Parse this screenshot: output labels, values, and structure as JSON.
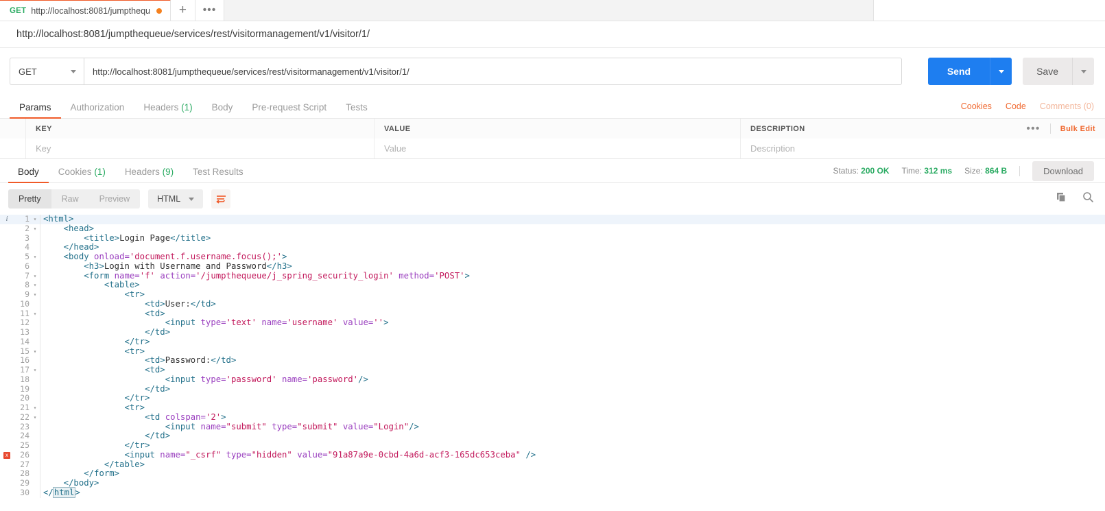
{
  "tab": {
    "method": "GET",
    "title": "http://localhost:8081/jumpthequ",
    "add_label": "+",
    "more_label": "•••"
  },
  "url_title": "http://localhost:8081/jumpthequeue/services/rest/visitormanagement/v1/visitor/1/",
  "request": {
    "method": "GET",
    "url": "http://localhost:8081/jumpthequeue/services/rest/visitormanagement/v1/visitor/1/",
    "send_label": "Send",
    "save_label": "Save"
  },
  "request_tabs": [
    {
      "label": "Params",
      "count": "",
      "active": true
    },
    {
      "label": "Authorization",
      "count": "",
      "active": false
    },
    {
      "label": "Headers",
      "count": "(1)",
      "active": false
    },
    {
      "label": "Body",
      "count": "",
      "active": false
    },
    {
      "label": "Pre-request Script",
      "count": "",
      "active": false
    },
    {
      "label": "Tests",
      "count": "",
      "active": false
    }
  ],
  "request_tabs_right": {
    "cookies": "Cookies",
    "code": "Code",
    "comments": "Comments (0)"
  },
  "params_table": {
    "headers": {
      "key": "KEY",
      "value": "VALUE",
      "description": "DESCRIPTION"
    },
    "placeholder_row": {
      "key": "Key",
      "value": "Value",
      "description": "Description"
    },
    "dots": "•••",
    "bulk_edit": "Bulk Edit"
  },
  "response_tabs": [
    {
      "label": "Body",
      "count": "",
      "active": true
    },
    {
      "label": "Cookies",
      "count": "(1)",
      "active": false
    },
    {
      "label": "Headers",
      "count": "(9)",
      "active": false
    },
    {
      "label": "Test Results",
      "count": "",
      "active": false
    }
  ],
  "response_meta": {
    "status_label": "Status:",
    "status_value": "200 OK",
    "time_label": "Time:",
    "time_value": "312 ms",
    "size_label": "Size:",
    "size_value": "864 B",
    "download": "Download"
  },
  "body_toolbar": {
    "views": [
      {
        "label": "Pretty",
        "active": true
      },
      {
        "label": "Raw",
        "active": false
      },
      {
        "label": "Preview",
        "active": false
      }
    ],
    "format": "HTML",
    "wrap_icon": "word-wrap-icon",
    "copy_icon": "copy-icon",
    "search_icon": "search-icon"
  },
  "colors": {
    "accent_orange": "#f05a28",
    "send_blue": "#1e7ef0",
    "status_green": "#2bab63",
    "error_red": "#e8492f"
  },
  "code": {
    "info_glyph": "i",
    "error_glyph": "x",
    "fold_glyph": "▾",
    "lines": [
      {
        "n": 1,
        "fold": true,
        "info": true,
        "error": false,
        "highlight": true,
        "indent": 0,
        "tokens": [
          {
            "t": "tag",
            "v": "<html>"
          }
        ]
      },
      {
        "n": 2,
        "fold": true,
        "info": false,
        "error": false,
        "highlight": false,
        "indent": 1,
        "tokens": [
          {
            "t": "tag",
            "v": "<head>"
          }
        ]
      },
      {
        "n": 3,
        "fold": false,
        "info": false,
        "error": false,
        "highlight": false,
        "indent": 2,
        "tokens": [
          {
            "t": "tag",
            "v": "<title>"
          },
          {
            "t": "txt",
            "v": "Login Page"
          },
          {
            "t": "tag",
            "v": "</title>"
          }
        ]
      },
      {
        "n": 4,
        "fold": false,
        "info": false,
        "error": false,
        "highlight": false,
        "indent": 1,
        "tokens": [
          {
            "t": "tag",
            "v": "</head>"
          }
        ]
      },
      {
        "n": 5,
        "fold": true,
        "info": false,
        "error": false,
        "highlight": false,
        "indent": 1,
        "tokens": [
          {
            "t": "tag",
            "v": "<body "
          },
          {
            "t": "attr",
            "v": "onload="
          },
          {
            "t": "str",
            "v": "'document.f.username.focus();'"
          },
          {
            "t": "tag",
            "v": ">"
          }
        ]
      },
      {
        "n": 6,
        "fold": false,
        "info": false,
        "error": false,
        "highlight": false,
        "indent": 2,
        "tokens": [
          {
            "t": "tag",
            "v": "<h3>"
          },
          {
            "t": "txt",
            "v": "Login with Username and Password"
          },
          {
            "t": "tag",
            "v": "</h3>"
          }
        ]
      },
      {
        "n": 7,
        "fold": true,
        "info": false,
        "error": false,
        "highlight": false,
        "indent": 2,
        "tokens": [
          {
            "t": "tag",
            "v": "<form "
          },
          {
            "t": "attr",
            "v": "name="
          },
          {
            "t": "str",
            "v": "'f'"
          },
          {
            "t": "txt",
            "v": " "
          },
          {
            "t": "attr",
            "v": "action="
          },
          {
            "t": "str",
            "v": "'/jumpthequeue/j_spring_security_login'"
          },
          {
            "t": "txt",
            "v": " "
          },
          {
            "t": "attr",
            "v": "method="
          },
          {
            "t": "str",
            "v": "'POST'"
          },
          {
            "t": "tag",
            "v": ">"
          }
        ]
      },
      {
        "n": 8,
        "fold": true,
        "info": false,
        "error": false,
        "highlight": false,
        "indent": 3,
        "tokens": [
          {
            "t": "tag",
            "v": "<table>"
          }
        ]
      },
      {
        "n": 9,
        "fold": true,
        "info": false,
        "error": false,
        "highlight": false,
        "indent": 4,
        "tokens": [
          {
            "t": "tag",
            "v": "<tr>"
          }
        ]
      },
      {
        "n": 10,
        "fold": false,
        "info": false,
        "error": false,
        "highlight": false,
        "indent": 5,
        "tokens": [
          {
            "t": "tag",
            "v": "<td>"
          },
          {
            "t": "txt",
            "v": "User:"
          },
          {
            "t": "tag",
            "v": "</td>"
          }
        ]
      },
      {
        "n": 11,
        "fold": true,
        "info": false,
        "error": false,
        "highlight": false,
        "indent": 5,
        "tokens": [
          {
            "t": "tag",
            "v": "<td>"
          }
        ]
      },
      {
        "n": 12,
        "fold": false,
        "info": false,
        "error": false,
        "highlight": false,
        "indent": 6,
        "tokens": [
          {
            "t": "tag",
            "v": "<input "
          },
          {
            "t": "attr",
            "v": "type="
          },
          {
            "t": "str",
            "v": "'text'"
          },
          {
            "t": "txt",
            "v": " "
          },
          {
            "t": "attr",
            "v": "name="
          },
          {
            "t": "str",
            "v": "'username'"
          },
          {
            "t": "txt",
            "v": " "
          },
          {
            "t": "attr",
            "v": "value="
          },
          {
            "t": "str",
            "v": "''"
          },
          {
            "t": "tag",
            "v": ">"
          }
        ]
      },
      {
        "n": 13,
        "fold": false,
        "info": false,
        "error": false,
        "highlight": false,
        "indent": 5,
        "tokens": [
          {
            "t": "tag",
            "v": "</td>"
          }
        ]
      },
      {
        "n": 14,
        "fold": false,
        "info": false,
        "error": false,
        "highlight": false,
        "indent": 4,
        "tokens": [
          {
            "t": "tag",
            "v": "</tr>"
          }
        ]
      },
      {
        "n": 15,
        "fold": true,
        "info": false,
        "error": false,
        "highlight": false,
        "indent": 4,
        "tokens": [
          {
            "t": "tag",
            "v": "<tr>"
          }
        ]
      },
      {
        "n": 16,
        "fold": false,
        "info": false,
        "error": false,
        "highlight": false,
        "indent": 5,
        "tokens": [
          {
            "t": "tag",
            "v": "<td>"
          },
          {
            "t": "txt",
            "v": "Password:"
          },
          {
            "t": "tag",
            "v": "</td>"
          }
        ]
      },
      {
        "n": 17,
        "fold": true,
        "info": false,
        "error": false,
        "highlight": false,
        "indent": 5,
        "tokens": [
          {
            "t": "tag",
            "v": "<td>"
          }
        ]
      },
      {
        "n": 18,
        "fold": false,
        "info": false,
        "error": false,
        "highlight": false,
        "indent": 6,
        "tokens": [
          {
            "t": "tag",
            "v": "<input "
          },
          {
            "t": "attr",
            "v": "type="
          },
          {
            "t": "str",
            "v": "'password'"
          },
          {
            "t": "txt",
            "v": " "
          },
          {
            "t": "attr",
            "v": "name="
          },
          {
            "t": "str",
            "v": "'password'"
          },
          {
            "t": "tag",
            "v": "/>"
          }
        ]
      },
      {
        "n": 19,
        "fold": false,
        "info": false,
        "error": false,
        "highlight": false,
        "indent": 5,
        "tokens": [
          {
            "t": "tag",
            "v": "</td>"
          }
        ]
      },
      {
        "n": 20,
        "fold": false,
        "info": false,
        "error": false,
        "highlight": false,
        "indent": 4,
        "tokens": [
          {
            "t": "tag",
            "v": "</tr>"
          }
        ]
      },
      {
        "n": 21,
        "fold": true,
        "info": false,
        "error": false,
        "highlight": false,
        "indent": 4,
        "tokens": [
          {
            "t": "tag",
            "v": "<tr>"
          }
        ]
      },
      {
        "n": 22,
        "fold": true,
        "info": false,
        "error": false,
        "highlight": false,
        "indent": 5,
        "tokens": [
          {
            "t": "tag",
            "v": "<td "
          },
          {
            "t": "attr",
            "v": "colspan="
          },
          {
            "t": "str",
            "v": "'2'"
          },
          {
            "t": "tag",
            "v": ">"
          }
        ]
      },
      {
        "n": 23,
        "fold": false,
        "info": false,
        "error": false,
        "highlight": false,
        "indent": 6,
        "tokens": [
          {
            "t": "tag",
            "v": "<input "
          },
          {
            "t": "attr",
            "v": "name="
          },
          {
            "t": "str",
            "v": "\"submit\""
          },
          {
            "t": "txt",
            "v": " "
          },
          {
            "t": "attr",
            "v": "type="
          },
          {
            "t": "str",
            "v": "\"submit\""
          },
          {
            "t": "txt",
            "v": " "
          },
          {
            "t": "attr",
            "v": "value="
          },
          {
            "t": "str",
            "v": "\"Login\""
          },
          {
            "t": "tag",
            "v": "/>"
          }
        ]
      },
      {
        "n": 24,
        "fold": false,
        "info": false,
        "error": false,
        "highlight": false,
        "indent": 5,
        "tokens": [
          {
            "t": "tag",
            "v": "</td>"
          }
        ]
      },
      {
        "n": 25,
        "fold": false,
        "info": false,
        "error": false,
        "highlight": false,
        "indent": 4,
        "tokens": [
          {
            "t": "tag",
            "v": "</tr>"
          }
        ]
      },
      {
        "n": 26,
        "fold": false,
        "info": false,
        "error": true,
        "highlight": false,
        "indent": 4,
        "tokens": [
          {
            "t": "tag",
            "v": "<input "
          },
          {
            "t": "attr",
            "v": "name="
          },
          {
            "t": "str",
            "v": "\"_csrf\""
          },
          {
            "t": "txt",
            "v": " "
          },
          {
            "t": "attr",
            "v": "type="
          },
          {
            "t": "str",
            "v": "\"hidden\""
          },
          {
            "t": "txt",
            "v": " "
          },
          {
            "t": "attr",
            "v": "value="
          },
          {
            "t": "str",
            "v": "\"91a87a9e-0cbd-4a6d-acf3-165dc653ceba\""
          },
          {
            "t": "txt",
            "v": " "
          },
          {
            "t": "tag",
            "v": "/>"
          }
        ]
      },
      {
        "n": 27,
        "fold": false,
        "info": false,
        "error": false,
        "highlight": false,
        "indent": 3,
        "tokens": [
          {
            "t": "tag",
            "v": "</table>"
          }
        ]
      },
      {
        "n": 28,
        "fold": false,
        "info": false,
        "error": false,
        "highlight": false,
        "indent": 2,
        "tokens": [
          {
            "t": "tag",
            "v": "</form>"
          }
        ]
      },
      {
        "n": 29,
        "fold": false,
        "info": false,
        "error": false,
        "highlight": false,
        "indent": 1,
        "tokens": [
          {
            "t": "tag",
            "v": "</body>"
          }
        ]
      },
      {
        "n": 30,
        "fold": false,
        "info": false,
        "error": false,
        "highlight": false,
        "indent": 0,
        "tokens": [
          {
            "t": "tag",
            "v": "</"
          },
          {
            "t": "tag-hl",
            "v": "html"
          },
          {
            "t": "tag",
            "v": ">"
          }
        ]
      }
    ]
  }
}
